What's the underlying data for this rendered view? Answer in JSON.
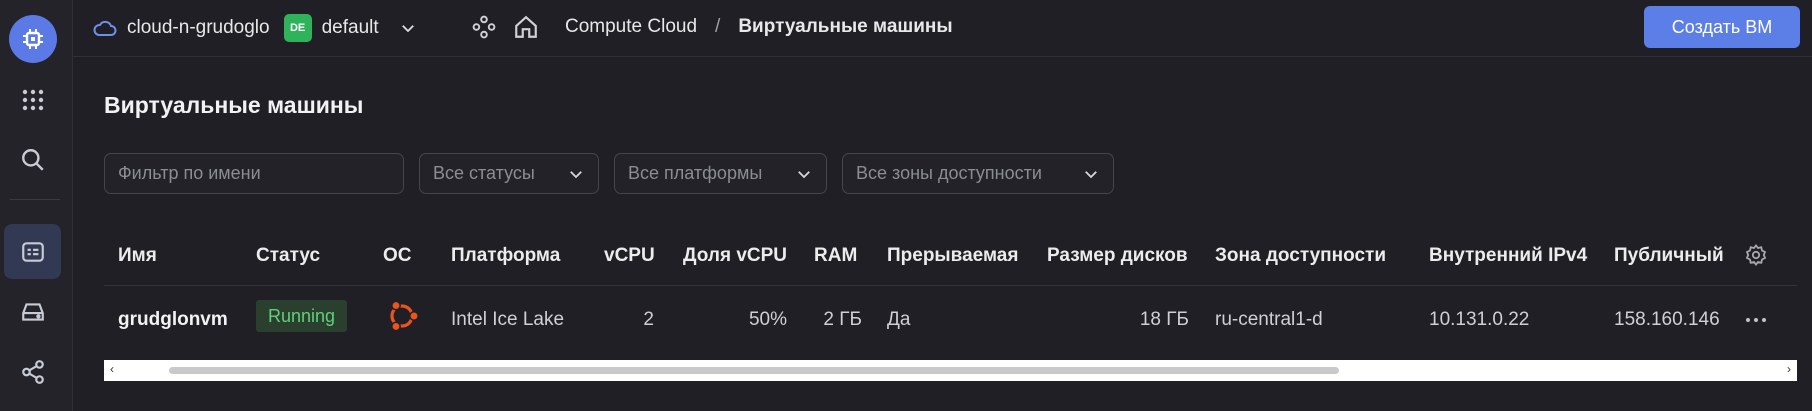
{
  "topbar": {
    "cloud_name": "cloud-n-grudoglo",
    "folder_badge": "DE",
    "folder_name": "default",
    "breadcrumb_root": "Compute Cloud",
    "breadcrumb_sep": "/",
    "breadcrumb_current": "Виртуальные машины",
    "create_button": "Создать ВМ"
  },
  "page": {
    "title": "Виртуальные машины"
  },
  "filters": {
    "name_placeholder": "Фильтр по имени",
    "status_selected": "Все статусы",
    "platform_selected": "Все платформы",
    "zone_selected": "Все зоны доступности"
  },
  "table": {
    "headers": {
      "name": "Имя",
      "status": "Статус",
      "os": "ОС",
      "platform": "Платформа",
      "vcpu": "vCPU",
      "vcpu_share": "Доля vCPU",
      "ram": "RAM",
      "preemptible": "Прерываемая",
      "disk_size": "Размер дисков",
      "zone": "Зона доступности",
      "internal_ip": "Внутренний IPv4",
      "public_ip": "Публичный"
    },
    "rows": [
      {
        "name": "grudglonvm",
        "status": "Running",
        "os_icon": "ubuntu-icon",
        "platform": "Intel Ice Lake",
        "vcpu": "2",
        "vcpu_share": "50%",
        "ram": "2 ГБ",
        "preemptible": "Да",
        "disk_size": "18 ГБ",
        "zone": "ru-central1-d",
        "internal_ip": "10.131.0.22",
        "public_ip": "158.160.146"
      }
    ]
  },
  "colors": {
    "accent": "#5b7fe6",
    "status_running": "#5fd07a",
    "ubuntu": "#e9541f",
    "background": "#1f1f25"
  },
  "icons": [
    "compute-logo-icon",
    "apps-grid-icon",
    "search-icon",
    "resources-icon",
    "storage-icon",
    "network-icon",
    "cloud-icon",
    "chevron-down-icon",
    "services-icon",
    "home-icon",
    "settings-gear-icon",
    "more-horizontal-icon"
  ]
}
